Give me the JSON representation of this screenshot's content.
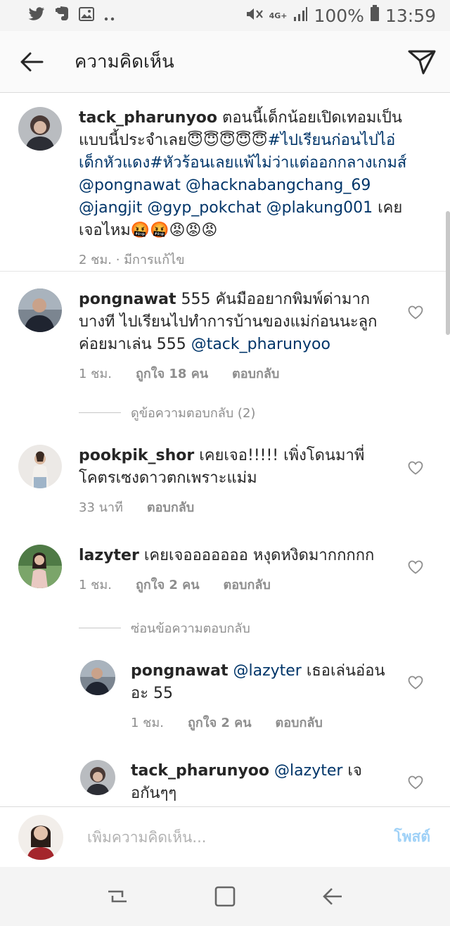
{
  "status_bar": {
    "icons": [
      "twitter-icon",
      "evernote-icon",
      "image-icon",
      "more-dots-icon"
    ],
    "network": "4G+",
    "battery": "100%",
    "time": "13:59"
  },
  "header": {
    "title": "ความคิดเห็น",
    "back_icon": "arrow-left-icon",
    "send_icon": "paper-plane-icon"
  },
  "caption": {
    "username": "tack_pharunyoo",
    "text": "ตอนนี้เด็กน้อยเปิดเทอมเป็นแบบนี้ประจำเลย😇😇😇😇😇",
    "hashtags": "#ไปเรียนก่อนไปไอ่เด็กหัวแดง#หัวร้อนเลยแพ้ไม่ว่าแต่ออกกลางเกมส์",
    "mentions": "@pongnawat @hacknabangchang_69 @jangjit @gyp_pokchat @plakung001",
    "tail": "เคยเจอไหม🤬🤬😡😡😡",
    "time": "2 ชม. · มีการแก้ไข"
  },
  "comments": [
    {
      "username": "pongnawat",
      "text": "555 คันมืออยากพิมพ์ด่ามาก บางที ไปเรียนไปทำการบ้านของแม่ก่อนนะลูก ค่อยมาเล่น 555",
      "mention": "@tack_pharunyoo",
      "time": "1 ชม.",
      "likes": "ถูกใจ 18 คน",
      "reply": "ตอบกลับ"
    },
    {
      "username": "pookpik_shor",
      "text": "เคยเจอ!!!!! เพิ่งโดนมาพี่ โคตรเซงดาวตกเพราะแม่ม",
      "time": "33 นาที",
      "reply": "ตอบกลับ"
    },
    {
      "username": "lazyter",
      "text": "เคยเจอออออออ หงุดหงิดมากกกกก",
      "time": "1 ชม.",
      "likes": "ถูกใจ 2 คน",
      "reply": "ตอบกลับ"
    }
  ],
  "view_replies": "ดูข้อความตอบกลับ (2)",
  "hide_replies": "ซ่อนข้อความตอบกลับ",
  "replies": [
    {
      "username": "pongnawat",
      "mention": "@lazyter",
      "text": "เธอเล่นอ่อนอะ 55",
      "time": "1 ชม.",
      "likes": "ถูกใจ 2 คน",
      "reply": "ตอบกลับ"
    },
    {
      "username": "tack_pharunyoo",
      "mention": "@lazyter",
      "text": "เจอกันๆๆ"
    }
  ],
  "compose": {
    "placeholder": "เพิ่มความคิดเห็น...",
    "post_label": "โพสต์"
  },
  "colors": {
    "link": "#003569",
    "meta": "#8e8e8e",
    "post_disabled": "#9fd1f7"
  }
}
